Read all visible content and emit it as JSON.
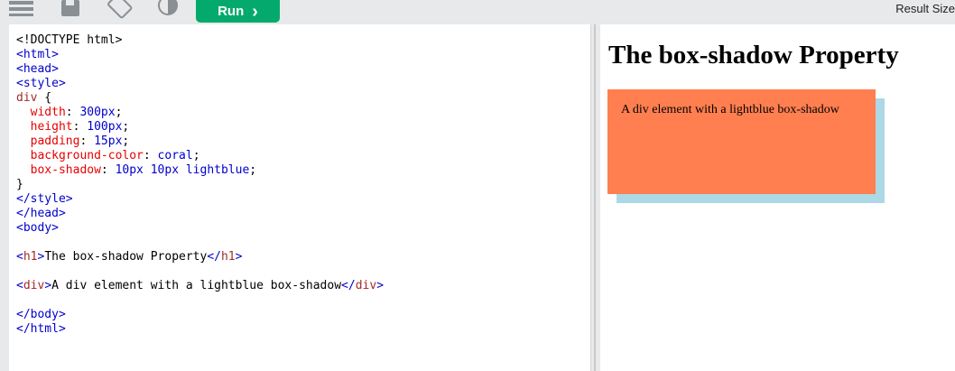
{
  "toolbar": {
    "icons": [
      "menu-icon",
      "save-icon",
      "rotate-icon",
      "contrast-icon"
    ],
    "run_label": "Run",
    "run_arrow": "›",
    "result_size_label": "Result Size"
  },
  "editor": {
    "lines": {
      "l1": "<!DOCTYPE html>",
      "l2_tag": "<html>",
      "l3_tag": "<head>",
      "l4_tag": "<style>",
      "l5_sel": "div",
      "l5_brace": " {",
      "l6_prop": "  width",
      "l6_val": "300px",
      "l7_prop": "  height",
      "l7_val": "100px",
      "l8_prop": "  padding",
      "l8_val": "15px",
      "l9_prop": "  background-color",
      "l9_val": "coral",
      "l10_prop": "  box-shadow",
      "l10_val": "10px 10px lightblue",
      "l11": "}",
      "l12_tag": "</style>",
      "l13_tag": "</head>",
      "l14_tag": "<body>",
      "l16_open_lt": "<",
      "l16_open_name": "h1",
      "l16_open_gt": ">",
      "l16_text": "The box-shadow Property",
      "l16_close_lt": "</",
      "l16_close_name": "h1",
      "l16_close_gt": ">",
      "l18_open_lt": "<",
      "l18_open_name": "div",
      "l18_open_gt": ">",
      "l18_text": "A div element with a lightblue box-shadow",
      "l18_close_lt": "</",
      "l18_close_name": "div",
      "l18_close_gt": ">",
      "l20_tag": "</body>",
      "l21_tag": "</html>"
    }
  },
  "result": {
    "heading": "The box-shadow Property",
    "div_text": "A div element with a lightblue box-shadow"
  },
  "colors": {
    "run_button": "#04aa6d",
    "tag": "#a52a2a",
    "property": "#e80000",
    "value": "#0000cd",
    "box_background": "coral",
    "box_shadow": "lightblue"
  }
}
